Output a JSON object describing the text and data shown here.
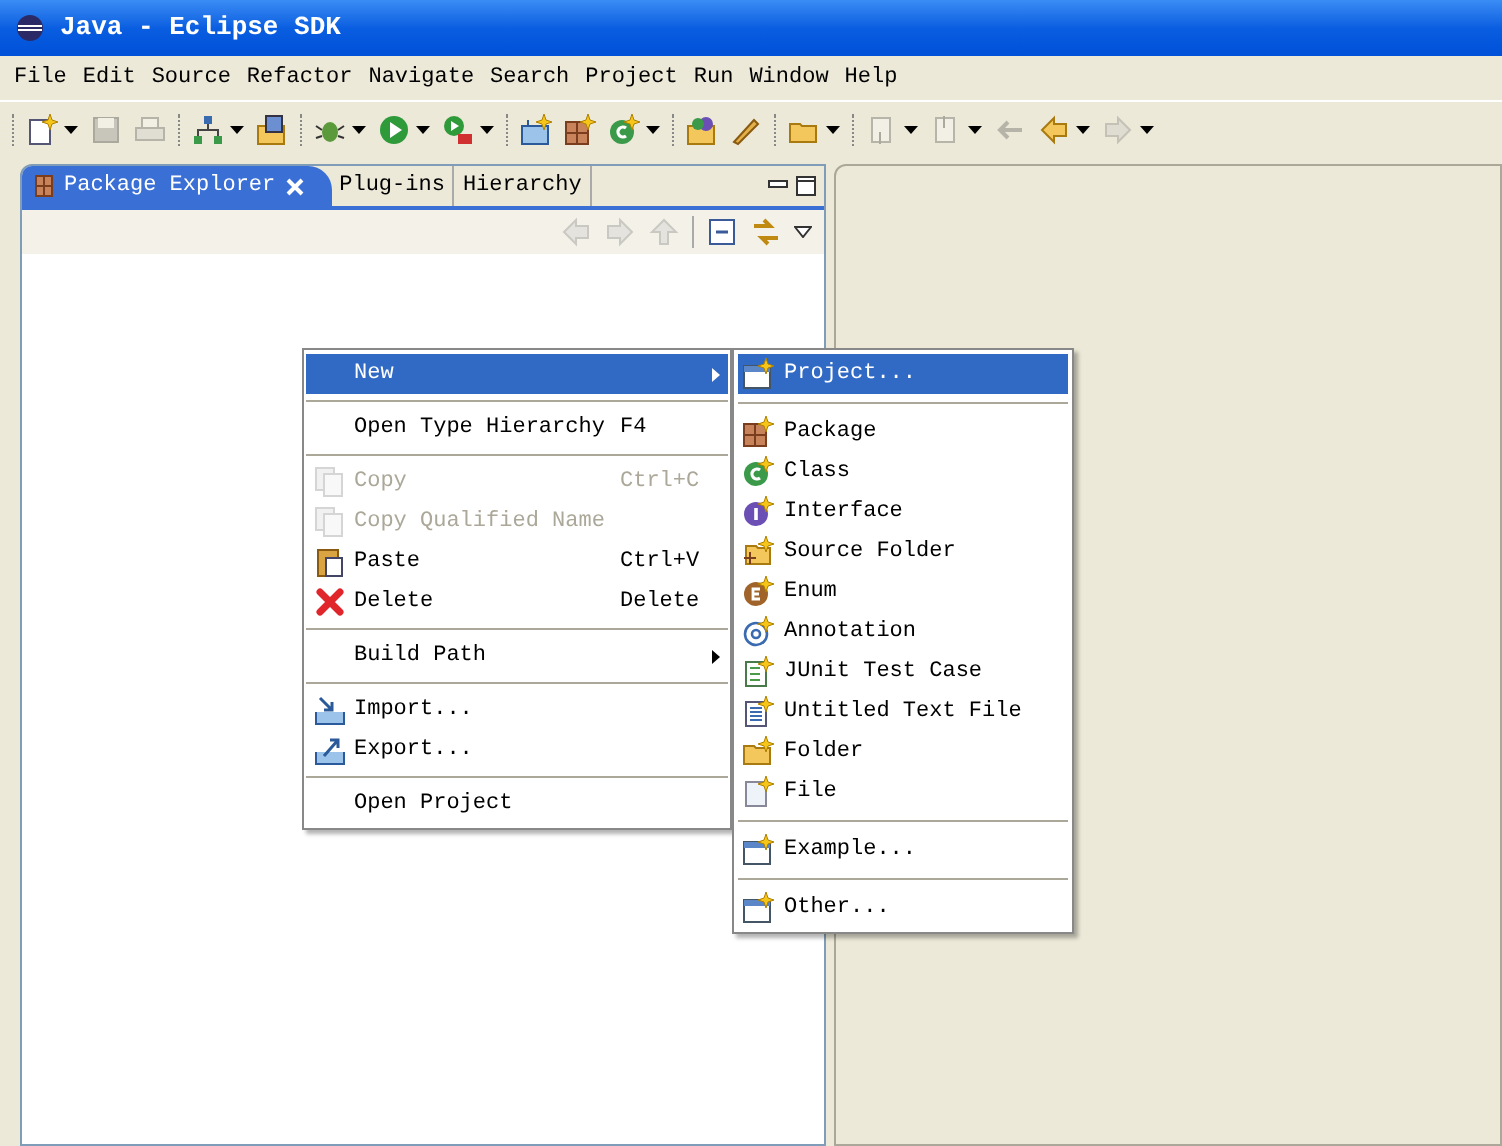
{
  "window": {
    "title": "Java - Eclipse SDK"
  },
  "menu_bar": [
    "File",
    "Edit",
    "Source",
    "Refactor",
    "Navigate",
    "Search",
    "Project",
    "Run",
    "Window",
    "Help"
  ],
  "toolbar": [
    [
      {
        "kind": "new",
        "disabled": false,
        "dropdown": true
      },
      {
        "kind": "save",
        "disabled": true,
        "dropdown": false
      },
      {
        "kind": "print",
        "disabled": true,
        "dropdown": false
      }
    ],
    [
      {
        "kind": "hierarchy",
        "disabled": false,
        "dropdown": true
      },
      {
        "kind": "open-type",
        "disabled": false,
        "dropdown": false
      }
    ],
    [
      {
        "kind": "debug",
        "disabled": false,
        "dropdown": true
      },
      {
        "kind": "run",
        "disabled": false,
        "dropdown": true
      },
      {
        "kind": "external",
        "disabled": false,
        "dropdown": true
      }
    ],
    [
      {
        "kind": "new-project",
        "disabled": false,
        "dropdown": false
      },
      {
        "kind": "package",
        "disabled": false,
        "dropdown": false
      },
      {
        "kind": "class",
        "disabled": false,
        "dropdown": true
      }
    ],
    [
      {
        "kind": "open-folder",
        "disabled": false,
        "dropdown": false
      },
      {
        "kind": "pen",
        "disabled": false,
        "dropdown": false
      }
    ],
    [
      {
        "kind": "folder",
        "disabled": false,
        "dropdown": true
      }
    ],
    [
      {
        "kind": "next-annotation",
        "disabled": true,
        "dropdown": true
      },
      {
        "kind": "prev-annotation",
        "disabled": true,
        "dropdown": true
      },
      {
        "kind": "last-edit",
        "disabled": true,
        "dropdown": false
      },
      {
        "kind": "back",
        "disabled": false,
        "dropdown": true
      },
      {
        "kind": "forward",
        "disabled": true,
        "dropdown": true
      }
    ]
  ],
  "tabs": [
    {
      "label": "Package Explorer",
      "selected": true
    },
    {
      "label": "Plug-ins",
      "selected": false
    },
    {
      "label": "Hierarchy",
      "selected": false
    }
  ],
  "view_toolbar": [
    {
      "kind": "back",
      "disabled": true
    },
    {
      "kind": "forward",
      "disabled": true
    },
    {
      "kind": "up",
      "disabled": true
    },
    {
      "kind": "collapse",
      "disabled": false
    },
    {
      "kind": "link",
      "disabled": false
    }
  ],
  "context_menu": [
    [
      {
        "label": "New",
        "kind": "plain",
        "disabled": false,
        "selected": true,
        "submenu": true
      }
    ],
    [
      {
        "label": "Open Type Hierarchy",
        "shortcut": "F4",
        "kind": "plain",
        "disabled": false,
        "selected": false,
        "submenu": false
      }
    ],
    [
      {
        "label": "Copy",
        "shortcut": "Ctrl+C",
        "kind": "copy",
        "disabled": true,
        "selected": false,
        "submenu": false
      },
      {
        "label": "Copy Qualified Name",
        "kind": "copy",
        "disabled": true,
        "selected": false,
        "submenu": false
      },
      {
        "label": "Paste",
        "shortcut": "Ctrl+V",
        "kind": "paste",
        "disabled": false,
        "selected": false,
        "submenu": false
      },
      {
        "label": "Delete",
        "shortcut": "Delete",
        "kind": "delete",
        "disabled": false,
        "selected": false,
        "submenu": false
      }
    ],
    [
      {
        "label": "Build Path",
        "kind": "plain",
        "disabled": false,
        "selected": false,
        "submenu": true
      }
    ],
    [
      {
        "label": "Import...",
        "kind": "import",
        "disabled": false,
        "selected": false,
        "submenu": false
      },
      {
        "label": "Export...",
        "kind": "export",
        "disabled": false,
        "selected": false,
        "submenu": false
      }
    ],
    [
      {
        "label": "Open Project",
        "kind": "plain",
        "disabled": false,
        "selected": false,
        "submenu": false
      }
    ]
  ],
  "submenu": [
    [
      {
        "label": "Project...",
        "kind": "project",
        "selected": true
      }
    ],
    [
      {
        "label": "Package",
        "kind": "package",
        "selected": false
      },
      {
        "label": "Class",
        "kind": "class",
        "selected": false
      },
      {
        "label": "Interface",
        "kind": "interface",
        "selected": false
      },
      {
        "label": "Source Folder",
        "kind": "source-folder",
        "selected": false
      },
      {
        "label": "Enum",
        "kind": "enum",
        "selected": false
      },
      {
        "label": "Annotation",
        "kind": "annotation",
        "selected": false
      },
      {
        "label": "JUnit Test Case",
        "kind": "junit",
        "selected": false
      },
      {
        "label": "Untitled Text File",
        "kind": "text-file",
        "selected": false
      },
      {
        "label": "Folder",
        "kind": "folder",
        "selected": false
      },
      {
        "label": "File",
        "kind": "file",
        "selected": false
      }
    ],
    [
      {
        "label": "Example...",
        "kind": "project",
        "selected": false
      }
    ],
    [
      {
        "label": "Other...",
        "kind": "project",
        "selected": false
      }
    ]
  ]
}
